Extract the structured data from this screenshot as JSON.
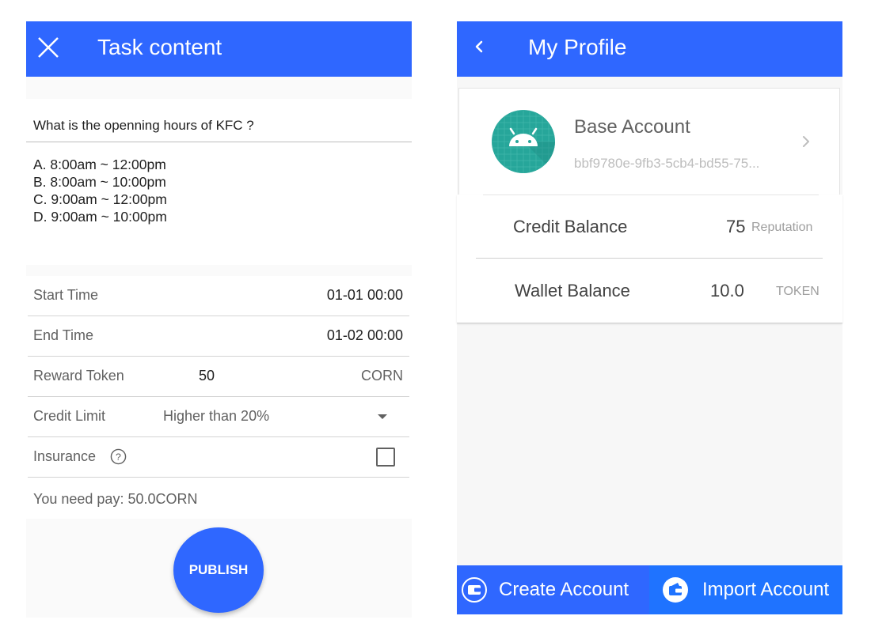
{
  "left_screen": {
    "title": "Task content",
    "question": "What is the openning hours of KFC ?",
    "options": [
      "A. 8:00am ~ 12:00pm",
      "B. 8:00am ~ 10:00pm",
      "C. 9:00am ~ 12:00pm",
      "D. 9:00am ~ 10:00pm"
    ],
    "form": {
      "start_time_label": "Start Time",
      "start_time_value": "01-01 00:00",
      "end_time_label": "End Time",
      "end_time_value": "01-02 00:00",
      "reward_label": "Reward Token",
      "reward_value": "50",
      "reward_unit": "CORN",
      "credit_limit_label": "Credit Limit",
      "credit_limit_value": "Higher than 20%",
      "insurance_label": "Insurance",
      "insurance_checked": false,
      "pay_text": "You need pay: 50.0CORN"
    },
    "publish_label": "PUBLISH"
  },
  "right_screen": {
    "title": "My Profile",
    "account": {
      "name": "Base Account",
      "id": "bbf9780e-9fb3-5cb4-bd55-75..."
    },
    "credit": {
      "label": "Credit Balance",
      "amount": "75",
      "unit": "Reputation"
    },
    "wallet": {
      "label": "Wallet Balance",
      "amount": "10.0",
      "unit": "TOKEN"
    },
    "create_account_label": "Create Account",
    "import_account_label": "Import Account"
  },
  "colors": {
    "primary": "#2f67ff",
    "android_green": "#26a69a"
  },
  "icons": [
    "close-icon",
    "help-circle-icon",
    "dropdown-arrow-icon",
    "checkbox-icon",
    "back-chevron-icon",
    "android-avatar-icon",
    "chevron-right-icon",
    "wallet-icon",
    "import-wallet-icon"
  ]
}
